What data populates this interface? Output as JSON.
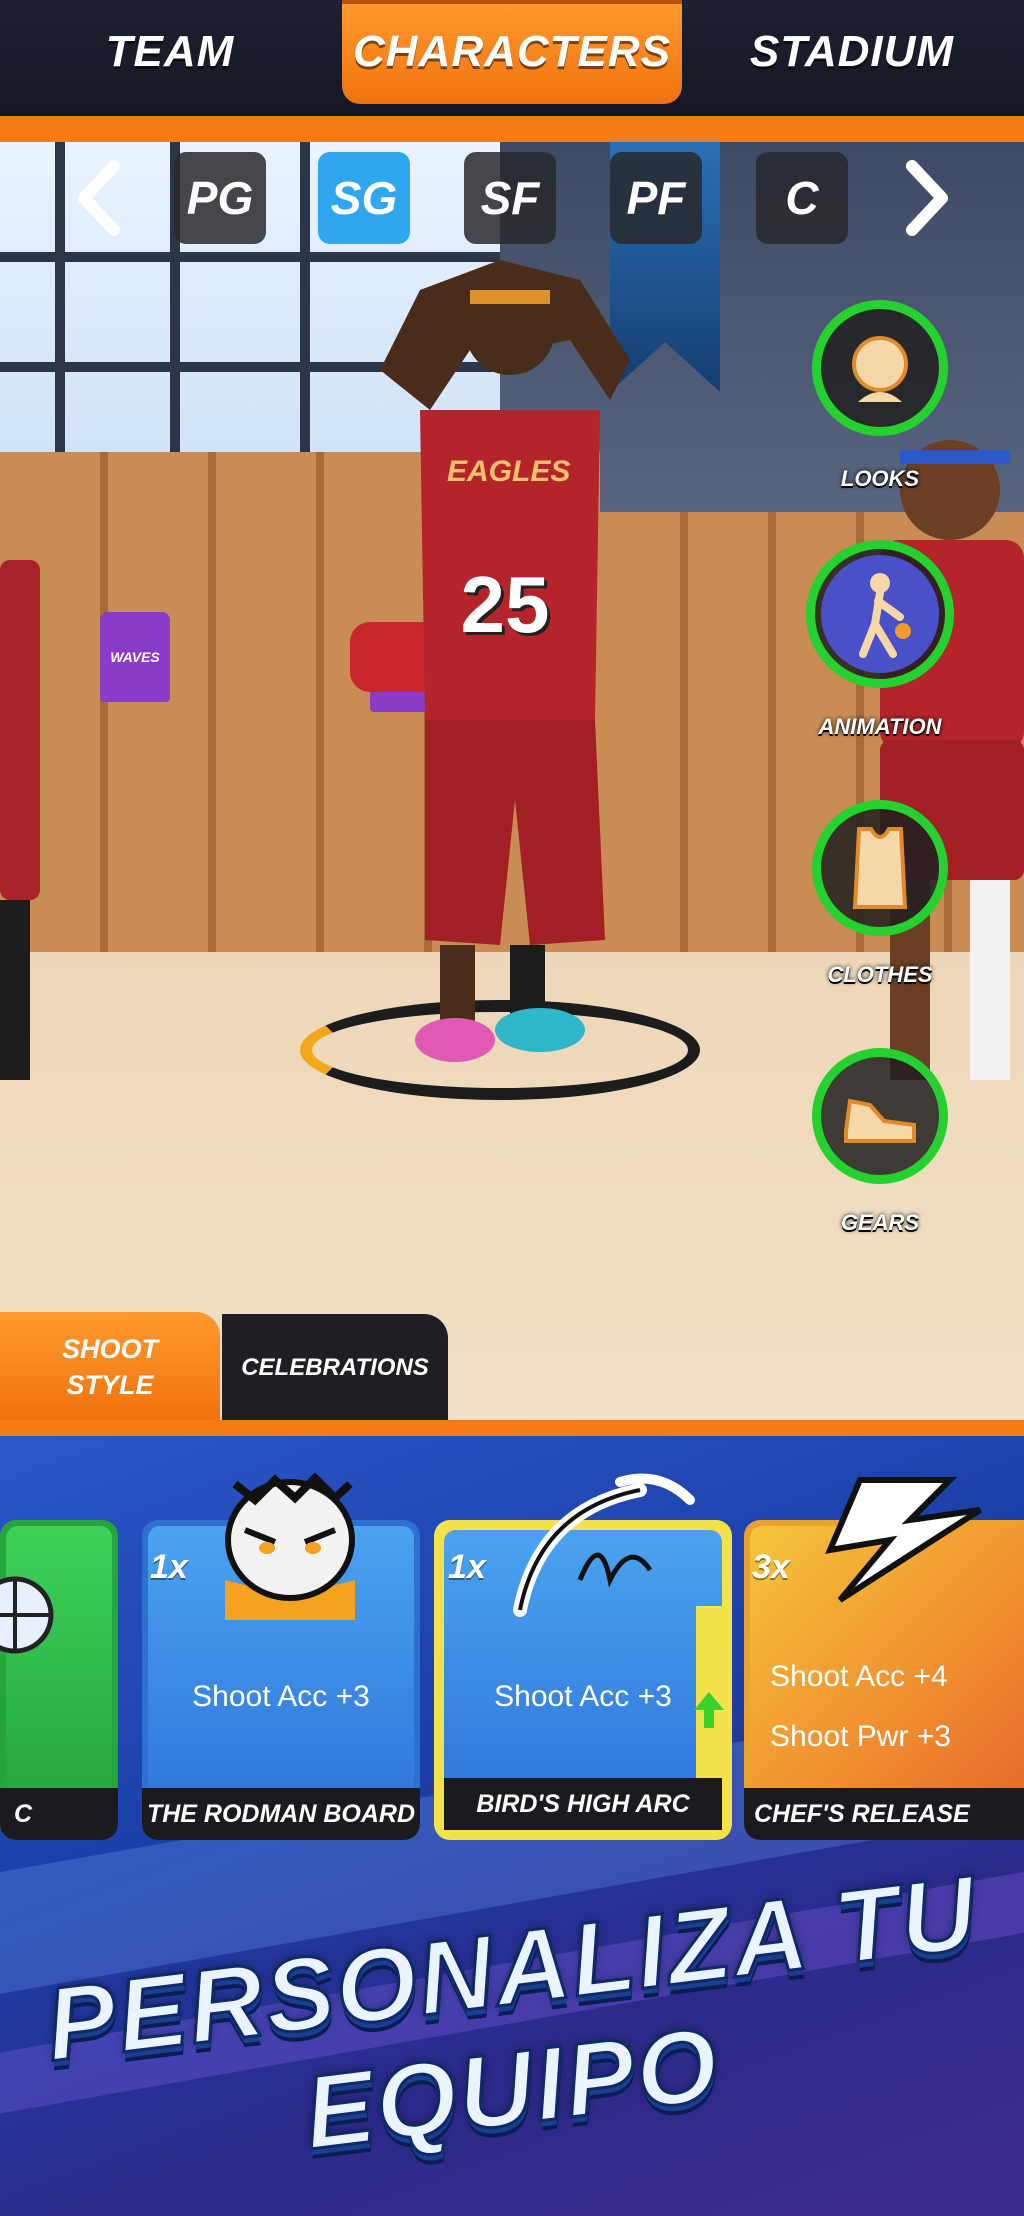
{
  "top_tabs": {
    "team": "TEAM",
    "characters": "CHARACTERS",
    "stadium": "STADIUM",
    "selected": "CHARACTERS"
  },
  "positions": {
    "items": [
      "PG",
      "SG",
      "SF",
      "PF",
      "C"
    ],
    "selected": "SG"
  },
  "scene": {
    "player_number": "25",
    "team_name": "EAGLES",
    "locker_jersey_text": "WAVES"
  },
  "side_menu": {
    "looks": "LOOKS",
    "animation": "ANIMATION",
    "clothes": "CLOTHES",
    "gears": "GEARS",
    "accent_color": "#25d12f"
  },
  "sub_tabs": {
    "shoot_style": "SHOOT STYLE",
    "celebrations": "CELEBRATIONS",
    "selected": "SHOOT STYLE"
  },
  "cards": [
    {
      "name": "C",
      "qty": "",
      "stats": [],
      "color": "#2fbf4a"
    },
    {
      "name": "THE RODMAN BOARD",
      "qty": "1x",
      "stats": [
        "Shoot Acc +3"
      ],
      "color": "#3f8ee8"
    },
    {
      "name": "BIRD'S HIGH ARC",
      "qty": "1x",
      "stats": [
        "Shoot Acc +3"
      ],
      "color": "#3f8ee8",
      "selected": true,
      "upgrade_arrow": true
    },
    {
      "name": "CHEF'S RELEASE",
      "qty": "3x",
      "stats": [
        "Shoot Acc +4",
        "Shoot Pwr +3"
      ],
      "color": "#f0b030"
    }
  ],
  "promo": {
    "line1": "PERSONALIZA TU",
    "line2": "EQUIPO"
  },
  "colors": {
    "orange": "#f47b16",
    "selected_blue": "#2ea6f0",
    "card_gold_border": "#f3e24a"
  }
}
